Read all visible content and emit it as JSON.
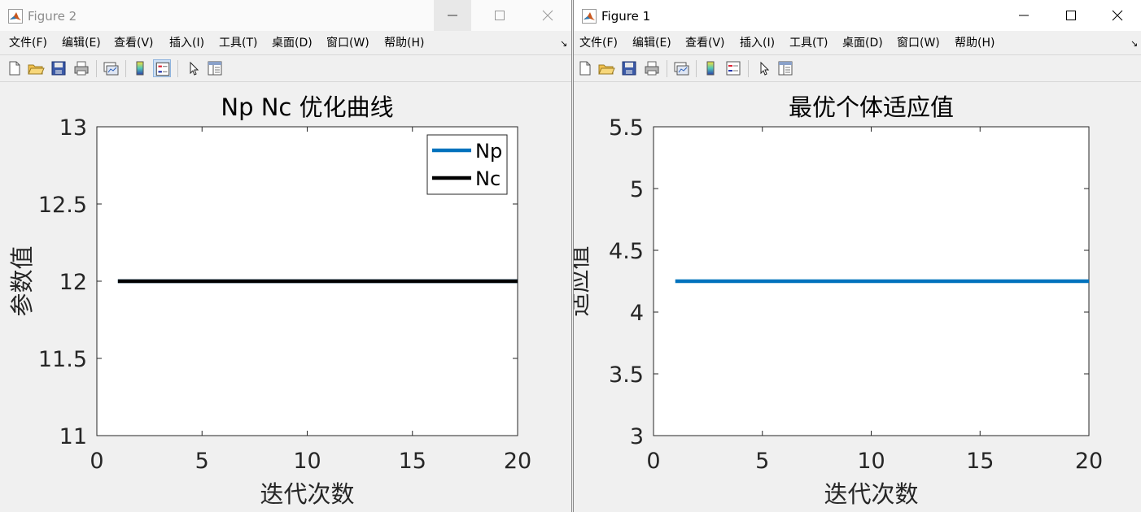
{
  "windows": [
    {
      "title": "Figure 2",
      "menus": [
        "文件(F)",
        "编辑(E)",
        "查看(V)",
        "插入(I)",
        "工具(T)",
        "桌面(D)",
        "窗口(W)",
        "帮助(H)"
      ],
      "menu_overflow": "↘"
    },
    {
      "title": "Figure 1",
      "menus": [
        "文件(F)",
        "编辑(E)",
        "查看(V)",
        "插入(I)",
        "工具(T)",
        "桌面(D)",
        "窗口(W)",
        "帮助(H)"
      ],
      "menu_overflow": "↘"
    }
  ],
  "toolbar_icons": [
    "new-figure-icon",
    "open-file-icon",
    "save-icon",
    "print-icon",
    "link-plot-icon",
    "colorbar-icon",
    "legend-icon",
    "edit-plot-arrow-icon",
    "property-inspector-icon"
  ],
  "colors": {
    "np_line": "#0072bd",
    "nc_line": "#000000",
    "fitness_line": "#0072bd",
    "axes_bg": "#ffffff",
    "figure_bg": "#f0f0f0"
  },
  "chart_data": [
    {
      "type": "line",
      "title": "Np Nc 优化曲线",
      "xlabel": "迭代次数",
      "ylabel": "参数值",
      "xlim": [
        0,
        20
      ],
      "ylim": [
        11,
        13
      ],
      "xticks": [
        "0",
        "5",
        "10",
        "15",
        "20"
      ],
      "yticks": [
        "11",
        "11.5",
        "12",
        "12.5",
        "13"
      ],
      "legend": {
        "entries": [
          "Np",
          "Nc"
        ],
        "location": "top-right"
      },
      "series": [
        {
          "name": "Np",
          "x": [
            1,
            20
          ],
          "y": [
            12,
            12
          ]
        },
        {
          "name": "Nc",
          "x": [
            1,
            20
          ],
          "y": [
            12,
            12
          ]
        }
      ]
    },
    {
      "type": "line",
      "title": "最优个体适应值",
      "xlabel": "迭代次数",
      "ylabel": "适应值",
      "xlim": [
        0,
        20
      ],
      "ylim": [
        3,
        5.5
      ],
      "xticks": [
        "0",
        "5",
        "10",
        "15",
        "20"
      ],
      "yticks": [
        "3",
        "3.5",
        "4",
        "4.5",
        "5",
        "5.5"
      ],
      "series": [
        {
          "x": [
            1,
            20
          ],
          "y": [
            4.25,
            4.25
          ]
        }
      ]
    }
  ]
}
